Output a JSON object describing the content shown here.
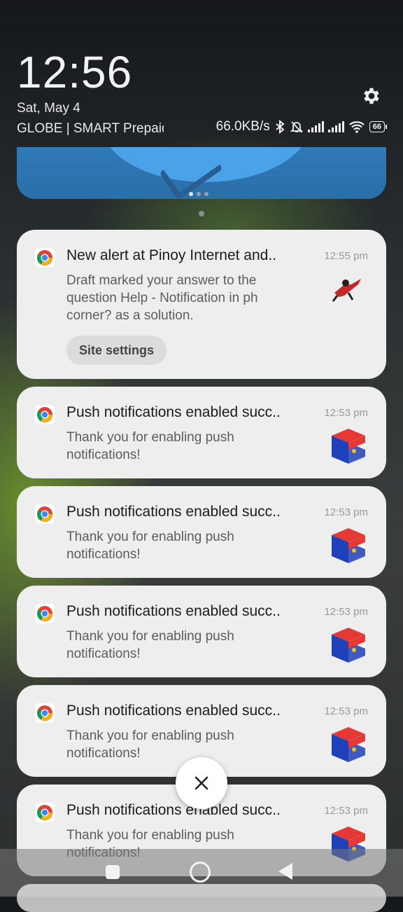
{
  "status": {
    "time": "12:56",
    "date": "Sat, May 4",
    "carrier": "GLOBE | SMART Prepaid",
    "speed": "66.0KB/s",
    "battery": "66"
  },
  "notifications": [
    {
      "title": "New alert at Pinoy Internet and..",
      "time": "12:55 pm",
      "body": "Draft marked your answer to the question Help - Notification in ph corner? as a solution.",
      "action": "Site settings",
      "thumb": "racer-thumbnail"
    },
    {
      "title": "Push notifications enabled succ..",
      "time": "12:53 pm",
      "body": "Thank you for enabling push notifications!",
      "thumb": "ph-flag-cube"
    },
    {
      "title": "Push notifications enabled succ..",
      "time": "12:53 pm",
      "body": "Thank you for enabling push notifications!",
      "thumb": "ph-flag-cube"
    },
    {
      "title": "Push notifications enabled succ..",
      "time": "12:53 pm",
      "body": "Thank you for enabling push notifications!",
      "thumb": "ph-flag-cube"
    },
    {
      "title": "Push notifications enabled succ..",
      "time": "12:53 pm",
      "body": "Thank you for enabling push notifications!",
      "thumb": "ph-flag-cube"
    },
    {
      "title": "Push notifications enabled succ..",
      "time": "12:53 pm",
      "body": "Thank you for enabling push notifications!",
      "thumb": "ph-flag-cube"
    }
  ],
  "icons": {
    "settings": "gear-icon",
    "app": "chrome-icon",
    "clear": "close-icon"
  },
  "colors": {
    "card_bg": "#eeeeee",
    "media_card": "#2f79b8"
  }
}
